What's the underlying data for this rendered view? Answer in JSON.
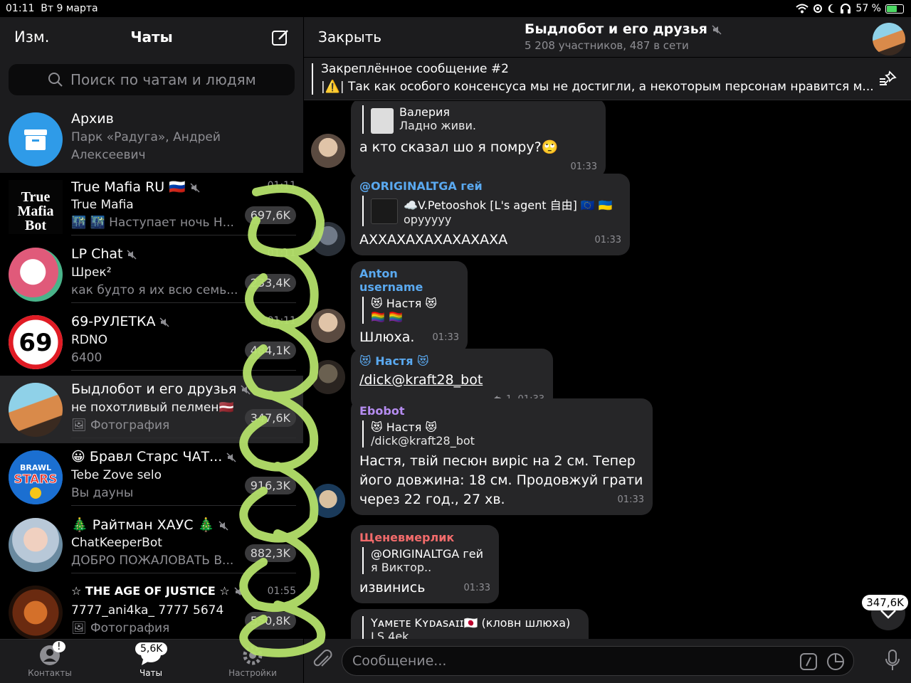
{
  "status": {
    "time": "01:11",
    "date": "Вт 9 марта",
    "battery_text": "57 %",
    "battery_level": 0.57
  },
  "sidebar": {
    "edit_label": "Изм.",
    "title": "Чаты",
    "search_placeholder": "Поиск по чатам и людям",
    "chats": [
      {
        "title": "Архив",
        "line1": "Парк «Радуга», Андрей",
        "line2": "Алексеевич"
      },
      {
        "title": "True Mafia RU 🇷🇺",
        "time": "01:11",
        "line1": "True Mafia",
        "line2": "🌃 🌃 Наступает ночь  Н...",
        "badge": "697,6K"
      },
      {
        "title": "LP Chat",
        "time": "01:11",
        "line1": "Шрек²",
        "line2": "как будто я их всю семь...",
        "badge": "233,4K"
      },
      {
        "title": "69-РУЛЕТКА",
        "time": "01:11",
        "line1": "RDNO",
        "line2": "6400",
        "badge": "484,1K"
      },
      {
        "title": "Быдлобот и его друзья",
        "line1": "не похотливый пелмен🇱🇻",
        "line2": "🖼 Фотография",
        "badge": "347,6K"
      },
      {
        "title": "😀 Бравл Старс ЧАТ...",
        "line1": "Tebe Zove selo",
        "line2": "Вы дауны",
        "badge": "916,3K"
      },
      {
        "title": "🎄 Райтман ХАУС 🎄",
        "line1": "ChatKeeperBot",
        "line2": "ДОБРО ПОЖАЛОВАТЬ В...",
        "badge": "882,3K"
      },
      {
        "title": "☆ THE AGE OF JUSTICE ☆",
        "time": "01:55",
        "line1": "7777_ani4ka_ 7777 5674",
        "line2": "🖼 Фотография",
        "badge": "550,8K"
      }
    ],
    "tabs": [
      {
        "label": "Контакты",
        "badge": "!"
      },
      {
        "label": "Чаты",
        "badge": "5,6K"
      },
      {
        "label": "Настройки"
      }
    ]
  },
  "chat": {
    "close_label": "Закрыть",
    "title": "Быдлобот и его друзья",
    "subtitle": "5 208 участников, 487 в сети",
    "pinned_title": "Закреплённое сообщение #2",
    "pinned_text": "|⚠️| Так как особого консенсуса мы не достигли, а некоторым персонам нравится м...",
    "messages": [
      {
        "reply_name": "Валерия",
        "reply_text": "Ладно живи.",
        "text": "а кто сказал шо я помру?🙄",
        "time": "01:33"
      },
      {
        "sender": "@ORIGINALTGA гей",
        "sender_color": "#5aa9f0",
        "reply_name": "☁️V.Petooshok [L's agent 自由] 🇪🇺 🇺🇦",
        "reply_text": "орууууу",
        "text": "АХХАХАХАХАХАХАХА",
        "time": "01:33"
      },
      {
        "sender": "Anton username",
        "sender_color": "#5aa9f0",
        "reply_name": "😻 Настя 😻",
        "reply_text": "🏳️‍🌈 🏳️‍🌈",
        "text": "Шлюха.",
        "time": "01:33"
      },
      {
        "sender": "😻 Настя 😻",
        "sender_color": "#5aa9f0",
        "text": "/dick@kraft28_bot",
        "reply_count": "1",
        "time": "01:33"
      },
      {
        "sender": "Ebobot",
        "sender_color": "#b58cf0",
        "reply_name": "😻 Настя 😻",
        "reply_text": "/dick@kraft28_bot",
        "text": "Настя, твій песюн виріс на 2 см. Тепер його довжина: 18 см. Продовжуй грати через 22 год., 27 хв.",
        "time": "01:33"
      },
      {
        "sender": "Щеневмерлик",
        "sender_color": "#f26b6b",
        "reply_name": "@ORIGINALTGA гей",
        "reply_text": "я Виктор..",
        "text": "извинись",
        "time": "01:33"
      },
      {
        "reply_name": "Yᴀᴍᴇᴛᴇ Kʏᴅᴀsᴀɪɪ🇯🇵 (кловн шлюха)",
        "reply_text": "LS 4ek"
      }
    ],
    "input_placeholder": "Сообщение...",
    "scroll_badge": "347,6K"
  }
}
